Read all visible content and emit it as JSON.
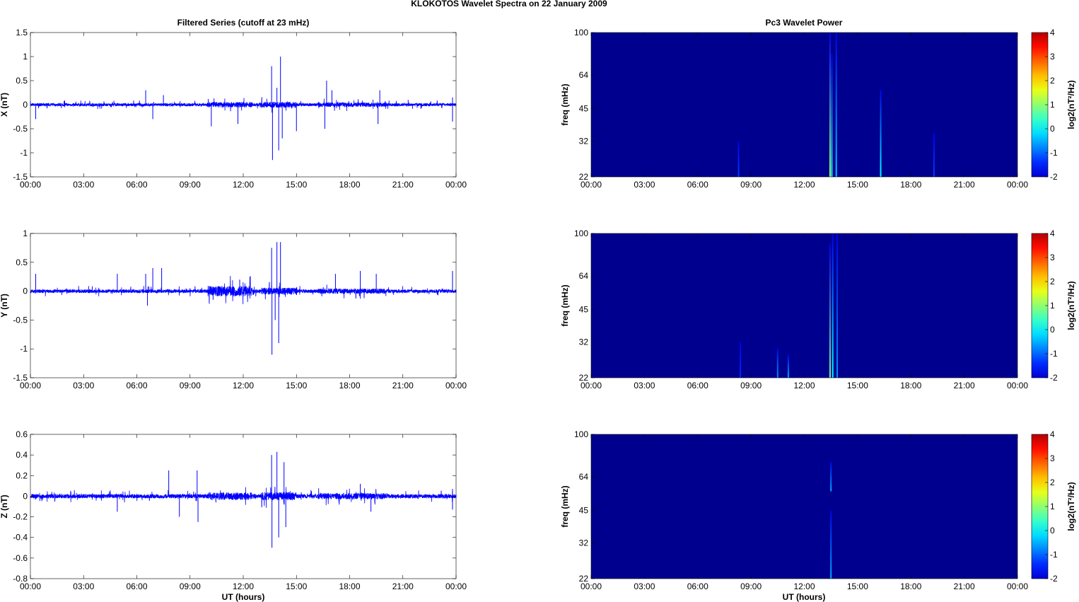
{
  "title": "KLOKOTOS Wavelet Spectra on 22 January   2009",
  "chart_data": {
    "left_title": "Filtered Series (cutoff at 23 mHz)",
    "right_title": "Pc3 Wavelet Power",
    "xlabel": "UT (hours)",
    "x_ticks": [
      "00:00",
      "03:00",
      "06:00",
      "09:00",
      "12:00",
      "15:00",
      "18:00",
      "21:00",
      "00:00"
    ],
    "xlim": [
      0,
      24
    ],
    "series_color": "#0000ff",
    "timeseries": [
      {
        "name": "X",
        "ylabel": "X (nT)",
        "type": "line",
        "ylim": [
          -1.5,
          1.5
        ],
        "yticks": [
          -1.5,
          -1,
          -0.5,
          0,
          0.5,
          1,
          1.5
        ],
        "noise": 0.03,
        "spikes": [
          [
            0.3,
            -0.3
          ],
          [
            6.5,
            0.3
          ],
          [
            6.9,
            -0.3
          ],
          [
            7.5,
            0.2
          ],
          [
            10.2,
            -0.45
          ],
          [
            11.7,
            -0.4
          ],
          [
            13.6,
            0.8
          ],
          [
            13.65,
            -1.15
          ],
          [
            13.9,
            0.35
          ],
          [
            14.0,
            -0.95
          ],
          [
            14.1,
            1.0
          ],
          [
            14.2,
            -0.7
          ],
          [
            15.0,
            -0.55
          ],
          [
            16.6,
            -0.5
          ],
          [
            16.7,
            0.5
          ],
          [
            17.0,
            0.3
          ],
          [
            19.6,
            -0.4
          ],
          [
            19.7,
            0.3
          ],
          [
            21.3,
            0.1
          ],
          [
            23.8,
            0.15
          ],
          [
            23.8,
            -0.35
          ]
        ]
      },
      {
        "name": "Y",
        "ylabel": "Y (nT)",
        "type": "line",
        "ylim": [
          -1.5,
          1
        ],
        "yticks": [
          -1.5,
          -1,
          -0.5,
          0,
          0.5,
          1
        ],
        "noise": 0.03,
        "spikes": [
          [
            0.3,
            0.3
          ],
          [
            4.9,
            0.3
          ],
          [
            6.5,
            0.3
          ],
          [
            6.6,
            -0.25
          ],
          [
            6.9,
            0.4
          ],
          [
            7.4,
            0.4
          ],
          [
            10.3,
            -0.15
          ],
          [
            11.8,
            0.2
          ],
          [
            13.6,
            0.75
          ],
          [
            13.62,
            -1.1
          ],
          [
            13.8,
            -0.5
          ],
          [
            13.9,
            0.85
          ],
          [
            14.0,
            -0.9
          ],
          [
            14.1,
            0.85
          ],
          [
            17.2,
            0.3
          ],
          [
            18.6,
            0.35
          ],
          [
            19.5,
            0.3
          ],
          [
            23.8,
            0.35
          ]
        ]
      },
      {
        "name": "Z",
        "ylabel": "Z (nT)",
        "type": "line",
        "ylim": [
          -0.8,
          0.6
        ],
        "yticks": [
          -0.8,
          -0.6,
          -0.4,
          -0.2,
          0,
          0.2,
          0.4,
          0.6
        ],
        "noise": 0.02,
        "spikes": [
          [
            4.9,
            -0.15
          ],
          [
            7.8,
            0.25
          ],
          [
            8.4,
            -0.2
          ],
          [
            9.4,
            0.25
          ],
          [
            9.45,
            -0.25
          ],
          [
            13.6,
            0.4
          ],
          [
            13.62,
            -0.5
          ],
          [
            13.9,
            0.43
          ],
          [
            14.0,
            -0.4
          ],
          [
            14.3,
            0.33
          ],
          [
            14.4,
            -0.3
          ],
          [
            18.6,
            0.12
          ],
          [
            19.2,
            -0.15
          ],
          [
            23.8,
            0.07
          ],
          [
            23.8,
            -0.13
          ]
        ]
      }
    ],
    "spectrograms": [
      {
        "type": "heatmap",
        "ylabel": "freq (mHz)",
        "yticks": [
          22,
          32,
          45,
          64,
          100
        ],
        "ylim": [
          22,
          100
        ],
        "streaks": [
          [
            13.45,
            22,
            100,
            0.8
          ],
          [
            13.55,
            22,
            80,
            0.5
          ],
          [
            13.8,
            22,
            100,
            0.4
          ],
          [
            16.3,
            22,
            55,
            0.5
          ],
          [
            8.3,
            22,
            32,
            0.15
          ],
          [
            19.3,
            22,
            35,
            0.15
          ]
        ]
      },
      {
        "type": "heatmap",
        "ylabel": "freq (mHz)",
        "yticks": [
          22,
          32,
          45,
          64,
          100
        ],
        "ylim": [
          22,
          100
        ],
        "streaks": [
          [
            13.45,
            22,
            90,
            0.7
          ],
          [
            13.6,
            22,
            100,
            0.5
          ],
          [
            13.85,
            22,
            100,
            0.3
          ],
          [
            10.5,
            22,
            30,
            0.3
          ],
          [
            11.1,
            22,
            28,
            0.35
          ],
          [
            8.4,
            22,
            32,
            0.12
          ]
        ]
      },
      {
        "type": "heatmap",
        "ylabel": "freq (mHz)",
        "yticks": [
          22,
          32,
          45,
          64,
          100
        ],
        "ylim": [
          22,
          100
        ],
        "streaks": [
          [
            13.5,
            22,
            45,
            0.35
          ],
          [
            13.5,
            55,
            75,
            0.15
          ]
        ]
      }
    ],
    "colorbar": {
      "label": "log2(nT²/Hz)",
      "ticks": [
        -2,
        -1,
        0,
        1,
        2,
        3,
        4
      ],
      "range": [
        -2,
        4
      ]
    }
  }
}
